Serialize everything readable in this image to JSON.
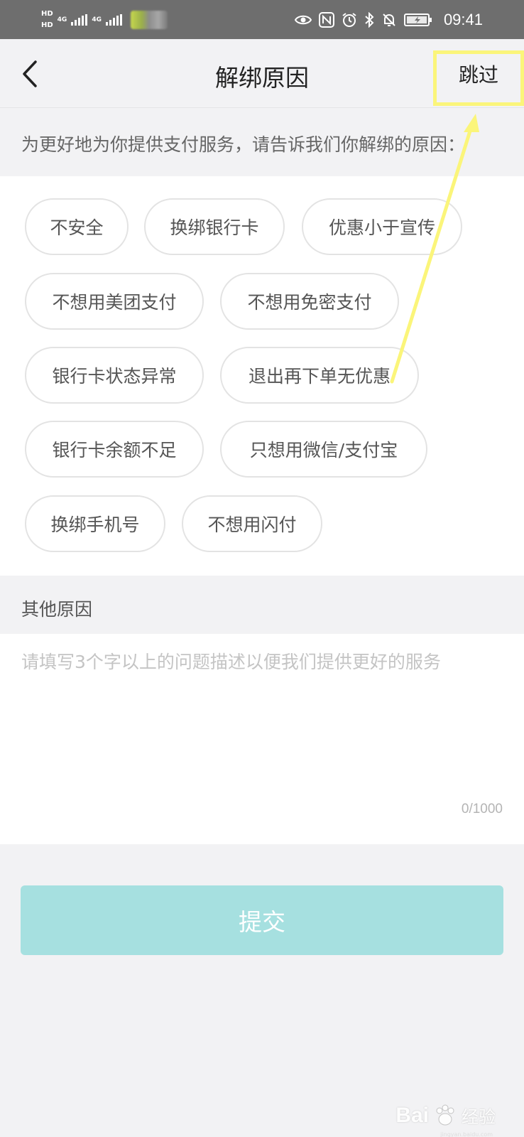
{
  "status_bar": {
    "hd_1": "HD",
    "hd_2": "HD",
    "net_1": "4G",
    "net_2": "4G",
    "time": "09:41",
    "icons": [
      "eye-icon",
      "nfc-icon",
      "alarm-icon",
      "bluetooth-icon",
      "mute-icon",
      "battery-icon"
    ]
  },
  "nav": {
    "title": "解绑原因",
    "skip_label": "跳过",
    "back_icon": "chevron-left-icon"
  },
  "hint": "为更好地为你提供支付服务，请告诉我们你解绑的原因：",
  "reasons": [
    "不安全",
    "换绑银行卡",
    "优惠小于宣传",
    "不想用美团支付",
    "不想用免密支付",
    "银行卡状态异常",
    "退出再下单无优惠",
    "银行卡余额不足",
    "只想用微信/支付宝",
    "换绑手机号",
    "不想用闪付"
  ],
  "other": {
    "label": "其他原因",
    "placeholder": "请填写3个字以上的问题描述以便我们提供更好的服务",
    "counter": "0/1000"
  },
  "submit_label": "提交",
  "watermark": {
    "brand": "Bai",
    "brand_suffix": "经验",
    "url": "jingyan.baidu.com"
  },
  "colors": {
    "highlight": "#fbf57a",
    "submit": "#a6e0e0",
    "background": "#f2f2f4"
  }
}
